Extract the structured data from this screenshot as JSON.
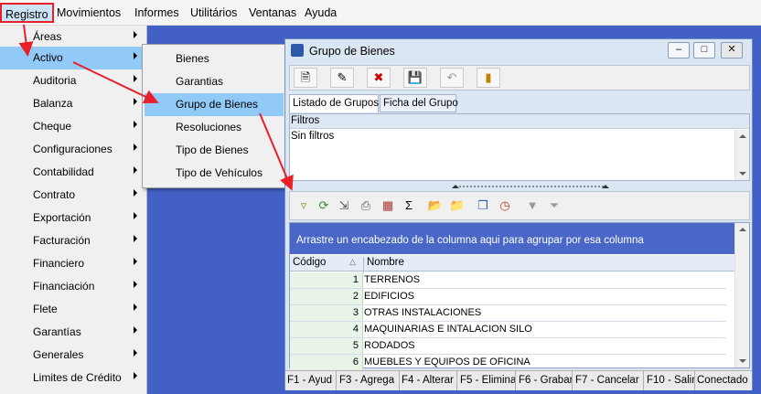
{
  "menubar": {
    "items": [
      "Registro",
      "Movimientos",
      "Informes",
      "Utilitários",
      "Ventanas",
      "Ayuda"
    ]
  },
  "menu_registro": {
    "items": [
      "Áreas",
      "Activo",
      "Auditoria",
      "Balanza",
      "Cheque",
      "Configuraciones",
      "Contabilidad",
      "Contrato",
      "Exportación",
      "Facturación",
      "Financiero",
      "Financiación",
      "Flete",
      "Garantías",
      "Generales",
      "Limites de Crédito"
    ]
  },
  "menu_activo": {
    "items": [
      "Bienes",
      "Garantias",
      "Grupo de Bienes",
      "Resoluciones",
      "Tipo de Bienes",
      "Tipo de Vehículos"
    ]
  },
  "window": {
    "title": "Grupo de Bienes",
    "tabs": [
      "Listado de Grupos",
      "Ficha del Grupo"
    ],
    "filters_header": "Filtros",
    "filters_text": "Sin filtros",
    "group_hint": "Arrastre un encabezado de la columna aqui para agrupar por esa columna",
    "columns": [
      "Código",
      "Nombre"
    ],
    "rows": [
      {
        "code": "1",
        "name": "TERRENOS"
      },
      {
        "code": "2",
        "name": "EDIFICIOS"
      },
      {
        "code": "3",
        "name": "OTRAS INSTALACIONES"
      },
      {
        "code": "4",
        "name": "MAQUINARIAS E INTALACION SILO"
      },
      {
        "code": "5",
        "name": "RODADOS"
      },
      {
        "code": "6",
        "name": "MUEBLES Y EQUIPOS DE OFICINA"
      }
    ],
    "status": [
      "F1 - Ayud",
      "F3 - Agrega",
      "F4 - Alterar",
      "F5 - Elimina",
      "F6 - Grabar",
      "F7 - Cancelar",
      "F10 - Salir",
      "Conectado"
    ]
  },
  "colors": {
    "highlight": "#91c9f7",
    "desktop": "#4360c7",
    "annotation_red": "#e8202a",
    "groupbar": "#4a67c8"
  }
}
